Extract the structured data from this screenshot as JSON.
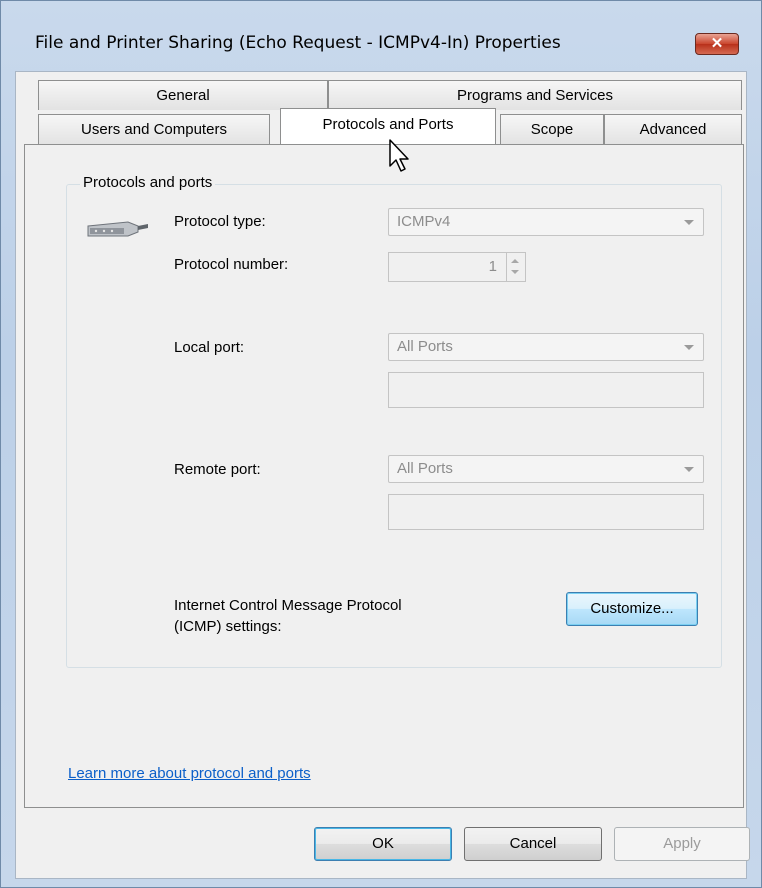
{
  "window": {
    "title": "File and Printer Sharing (Echo Request - ICMPv4-In) Properties"
  },
  "tabs": {
    "row1": [
      {
        "label": "General"
      },
      {
        "label": "Programs and Services"
      }
    ],
    "row2": [
      {
        "label": "Users and Computers"
      },
      {
        "label": "Protocols and Ports"
      },
      {
        "label": "Scope"
      },
      {
        "label": "Advanced"
      }
    ],
    "active": "Protocols and Ports"
  },
  "group": {
    "title": "Protocols and ports",
    "protocol_type": {
      "label": "Protocol type:",
      "value": "ICMPv4"
    },
    "protocol_number": {
      "label": "Protocol number:",
      "value": "1"
    },
    "local_port": {
      "label": "Local port:",
      "value": "All Ports",
      "text": ""
    },
    "remote_port": {
      "label": "Remote port:",
      "value": "All Ports",
      "text": ""
    },
    "icmp": {
      "label_line1": "Internet Control Message Protocol",
      "label_line2": "(ICMP) settings:",
      "button": "Customize..."
    }
  },
  "link": {
    "label": "Learn more about protocol and ports"
  },
  "buttons": {
    "ok": "OK",
    "cancel": "Cancel",
    "apply": "Apply"
  },
  "icons": {
    "close": "close-icon",
    "protocol": "network-cable-icon",
    "cursor": "mouse-pointer-icon"
  }
}
